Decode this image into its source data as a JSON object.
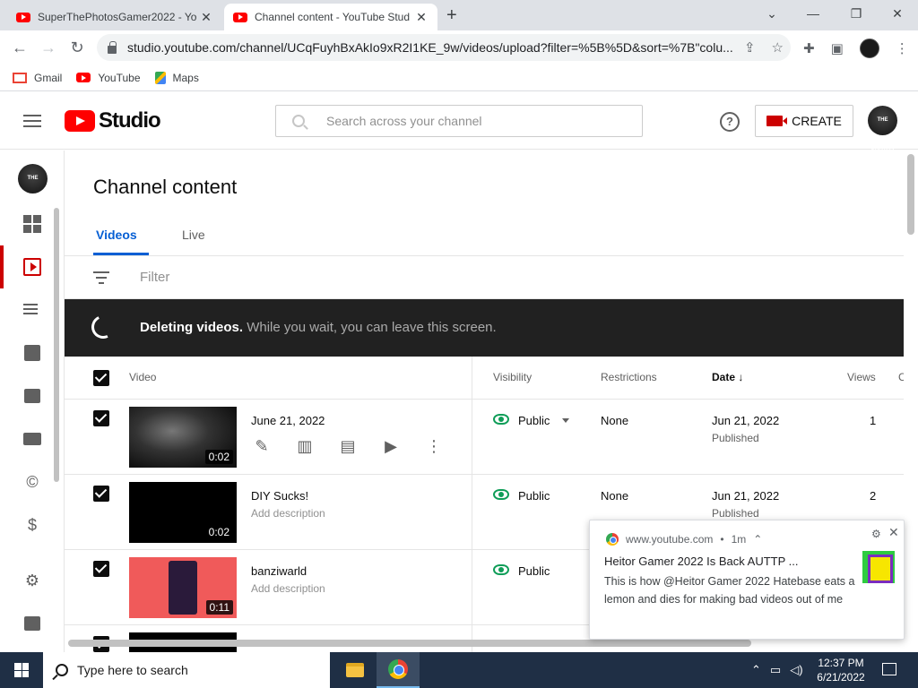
{
  "browser": {
    "tabs": [
      {
        "title": "SuperThePhotosGamer2022 - Yo",
        "active": false
      },
      {
        "title": "Channel content - YouTube Stud",
        "active": true
      }
    ],
    "url": "studio.youtube.com/channel/UCqFuyhBxAkIo9xR2I1KE_9w/videos/upload?filter=%5B%5D&sort=%7B\"colu...",
    "bookmarks": [
      "Gmail",
      "YouTube",
      "Maps"
    ]
  },
  "header": {
    "logo_text": "Studio",
    "search_placeholder": "Search across your channel",
    "help_glyph": "?",
    "create_label": "CREATE",
    "avatar_text": "THE PHOTOS"
  },
  "page": {
    "title": "Channel content",
    "tabs": [
      "Videos",
      "Live"
    ],
    "filter_placeholder": "Filter"
  },
  "banner": {
    "bold": "Deleting videos.",
    "text": " While you wait, you can leave this screen."
  },
  "table": {
    "headers": {
      "video": "Video",
      "visibility": "Visibility",
      "restrictions": "Restrictions",
      "date": "Date",
      "views": "Views",
      "comments": "C"
    },
    "rows": [
      {
        "title": "June 21, 2022",
        "description": "",
        "duration": "0:02",
        "visibility": "Public",
        "restrictions": "None",
        "date": "Jun 21, 2022",
        "date_status": "Published",
        "views": "1"
      },
      {
        "title": "DIY Sucks!",
        "description": "Add description",
        "duration": "0:02",
        "visibility": "Public",
        "restrictions": "None",
        "date": "Jun 21, 2022",
        "date_status": "Published",
        "views": "2"
      },
      {
        "title": "banziwarld",
        "description": "Add description",
        "duration": "0:11",
        "visibility": "Public",
        "restrictions": "",
        "date": "",
        "date_status": "",
        "views": ""
      }
    ]
  },
  "notification": {
    "source": "www.youtube.com",
    "age": "1m",
    "title": "Heitor Gamer 2022 Is Back AUTTP ...",
    "body": "This is how @Heitor Gamer 2022 Hatebase eats a lemon and dies for making bad videos out of me"
  },
  "taskbar": {
    "search_placeholder": "Type here to search",
    "time": "12:37 PM",
    "date": "6/21/2022"
  },
  "colors": {
    "accent_blue": "#065fd4",
    "brand_red": "#ff0000",
    "public_green": "#0f9d58",
    "banner_bg": "#212121"
  }
}
